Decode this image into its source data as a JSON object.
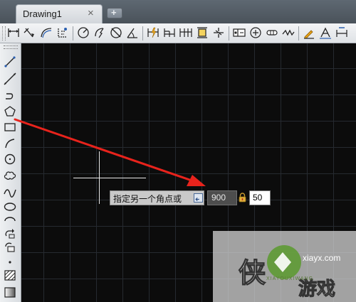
{
  "tab": {
    "title": "Drawing1",
    "close_glyph": "×",
    "new_glyph": "+"
  },
  "toolbar": {
    "icons": [
      "linear-dimension-icon",
      "aligned-dimension-icon",
      "arc-length-dimension-icon",
      "ordinate-dimension-icon",
      "radius-dimension-icon",
      "jogged-dimension-icon",
      "diameter-dimension-icon",
      "angular-dimension-icon",
      "quick-dimension-icon",
      "baseline-dimension-icon",
      "continue-dimension-icon",
      "dimension-space-icon",
      "dimension-break-icon",
      "tolerance-icon",
      "center-mark-icon",
      "inspection-icon",
      "jogged-linear-icon",
      "dimension-edit-icon",
      "dimension-text-edit-icon",
      "dimension-update-icon"
    ]
  },
  "left_toolbar": {
    "icons": [
      "line-icon",
      "construction-line-icon",
      "polyline-icon",
      "polygon-icon",
      "rectangle-icon",
      "arc-icon",
      "circle-icon",
      "revision-cloud-icon",
      "spline-icon",
      "ellipse-icon",
      "ellipse-arc-icon",
      "insert-block-icon",
      "make-block-icon",
      "point-icon",
      "hatch-icon",
      "gradient-icon"
    ]
  },
  "dynamic_input": {
    "prompt": "指定另一个角点或",
    "value_1": "900",
    "value_2": "50"
  },
  "annotation": {
    "color": "#e8231c"
  },
  "watermark": {
    "site": "xiayx.com",
    "subtitle": "XIAYOUXIWANG",
    "brand": "侠游戏"
  },
  "colors": {
    "canvas": "#0c0c0c",
    "grid": "#262a30",
    "crosshair": "#e8e8e8"
  }
}
